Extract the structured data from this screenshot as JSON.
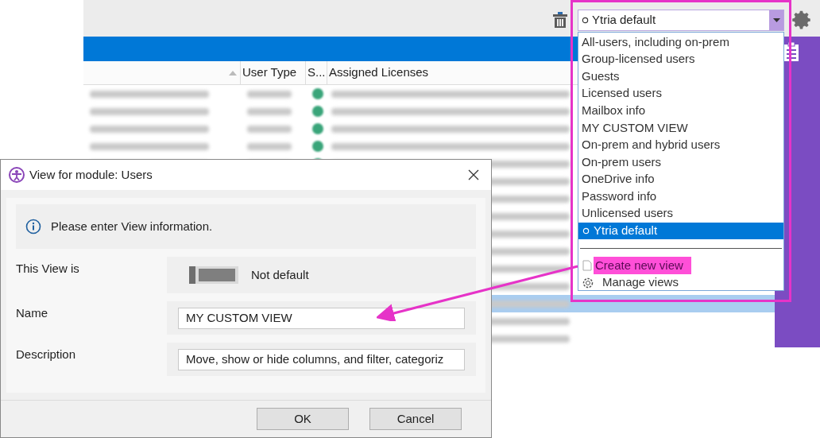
{
  "table": {
    "columns": [
      {
        "label": "User Type"
      },
      {
        "label": "S..."
      },
      {
        "label": "Assigned Licenses"
      }
    ],
    "rows": [
      {
        "selected": false
      },
      {
        "selected": false
      },
      {
        "selected": false
      },
      {
        "selected": false
      },
      {
        "selected": false
      },
      {
        "selected": false
      },
      {
        "selected": false
      },
      {
        "selected": false
      },
      {
        "selected": false
      },
      {
        "selected": false
      },
      {
        "selected": false
      },
      {
        "selected": false
      },
      {
        "selected": true
      },
      {
        "selected": false
      },
      {
        "selected": false
      }
    ]
  },
  "view_combo": {
    "value": "Ytria default"
  },
  "view_menu": {
    "items": [
      {
        "kind": "option",
        "label": "All-users, including on-prem",
        "selected": false,
        "highlighted": false
      },
      {
        "kind": "option",
        "label": "Group-licensed users",
        "selected": false,
        "highlighted": false
      },
      {
        "kind": "option",
        "label": "Guests",
        "selected": false,
        "highlighted": false
      },
      {
        "kind": "option",
        "label": "Licensed users",
        "selected": false,
        "highlighted": false
      },
      {
        "kind": "option",
        "label": "Mailbox info",
        "selected": false,
        "highlighted": false
      },
      {
        "kind": "option",
        "label": "MY CUSTOM VIEW",
        "selected": false,
        "highlighted": false
      },
      {
        "kind": "option",
        "label": "On-prem and hybrid users",
        "selected": false,
        "highlighted": false
      },
      {
        "kind": "option",
        "label": "On-prem users",
        "selected": false,
        "highlighted": false
      },
      {
        "kind": "option",
        "label": "OneDrive info",
        "selected": false,
        "highlighted": false
      },
      {
        "kind": "option",
        "label": "Password info",
        "selected": false,
        "highlighted": false
      },
      {
        "kind": "option",
        "label": "Unlicensed users",
        "selected": false,
        "highlighted": false
      },
      {
        "kind": "default",
        "label": "Ytria default",
        "selected": true,
        "highlighted": false
      },
      {
        "kind": "separator"
      },
      {
        "kind": "new",
        "label": "Create new view",
        "selected": false,
        "highlighted": true
      },
      {
        "kind": "manage",
        "label": "Manage views",
        "selected": false,
        "highlighted": false
      }
    ]
  },
  "dialog": {
    "title": "View for module: Users",
    "info": "Please enter View information.",
    "fields": [
      {
        "kind": "toggle",
        "label": "This View is",
        "on": false,
        "state_text": "Not default"
      },
      {
        "kind": "text",
        "label": "Name",
        "value": "MY CUSTOM VIEW"
      },
      {
        "kind": "text",
        "label": "Description",
        "value": "Move, show or hide columns, and filter, categoriz"
      }
    ],
    "buttons": [
      "OK",
      "Cancel"
    ]
  }
}
